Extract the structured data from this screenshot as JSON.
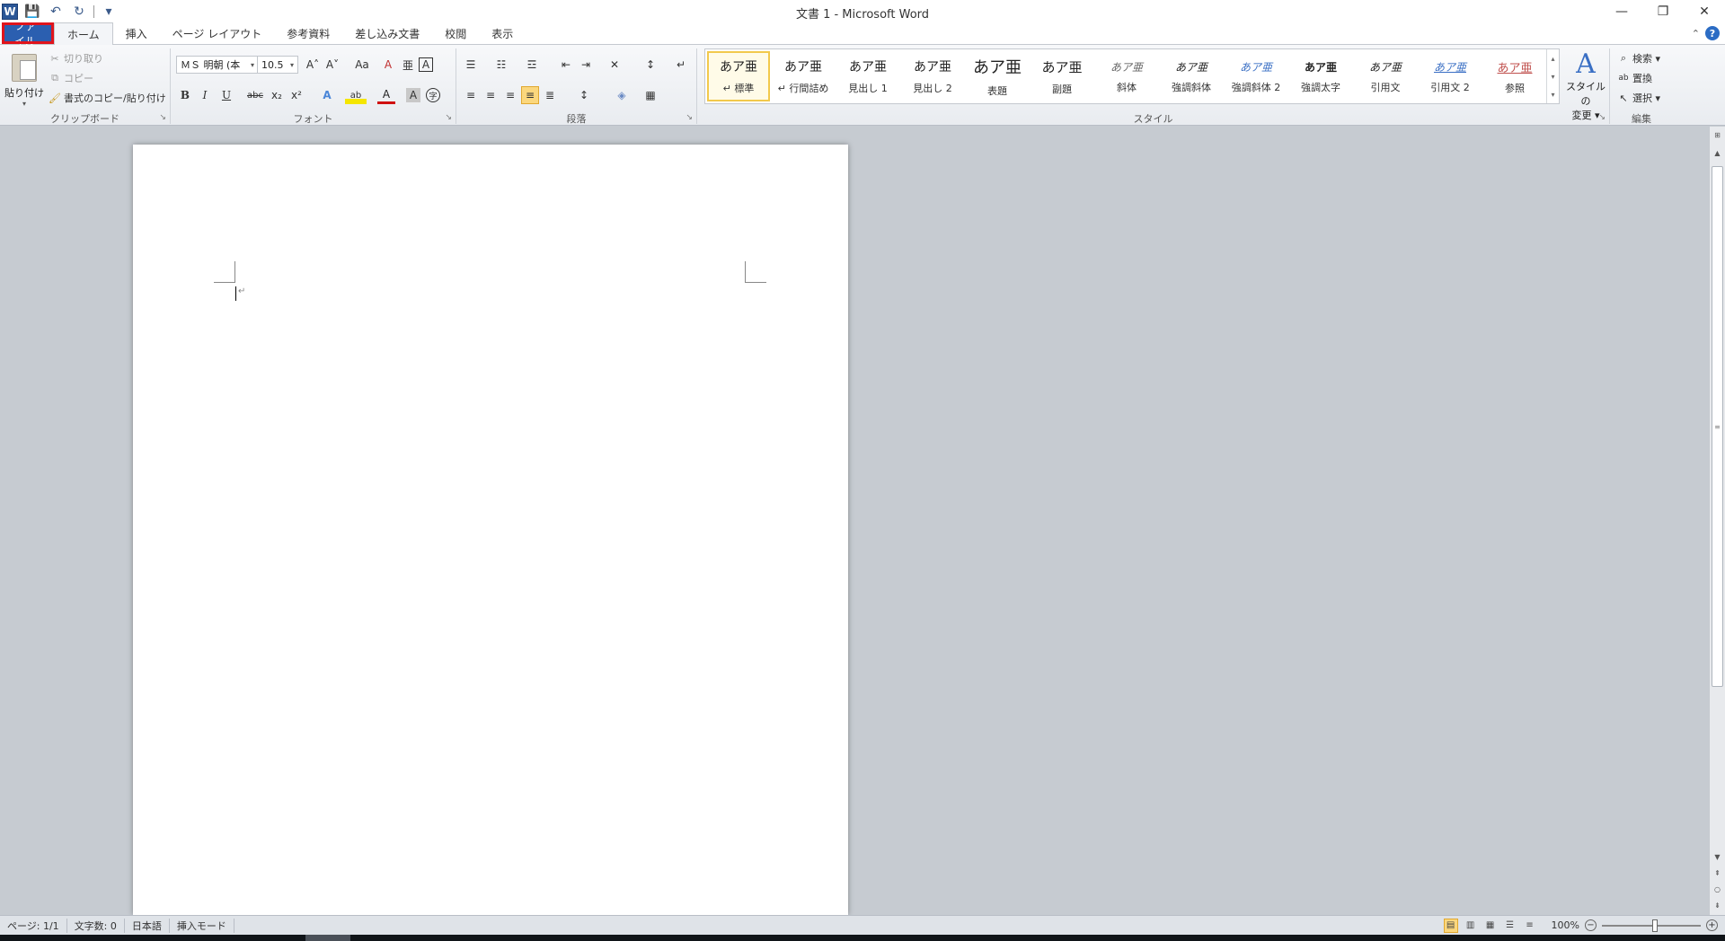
{
  "window": {
    "title": "文書 1 - Microsoft Word",
    "minimize": "—",
    "restore": "❐",
    "close": "✕"
  },
  "qat": {
    "logo": "W",
    "save": "💾",
    "undo": "↶",
    "redo": "↻",
    "customize": "▾"
  },
  "tabs": {
    "file": "ファイル",
    "items": [
      "ホーム",
      "挿入",
      "ページ レイアウト",
      "参考資料",
      "差し込み文書",
      "校閲",
      "表示"
    ],
    "minimize_ribbon": "⌃",
    "help": "?"
  },
  "clipboard": {
    "group_label": "クリップボード",
    "paste": "貼り付け",
    "cut": "切り取り",
    "copy": "コピー",
    "format_painter": "書式のコピー/貼り付け"
  },
  "font": {
    "group_label": "フォント",
    "font_name": "ＭＳ 明朝 (本",
    "font_size": "10.5",
    "grow": "A˄",
    "shrink": "A˅",
    "case": "Aa",
    "clear": "A",
    "phonetic": "亜",
    "border": "A",
    "bold": "B",
    "italic": "I",
    "underline": "U",
    "strike": "abc",
    "subscript": "x₂",
    "superscript": "x²",
    "effects": "A",
    "highlight": "ab",
    "color": "A",
    "shade": "A",
    "enclose": "字"
  },
  "paragraph": {
    "group_label": "段落",
    "bullets": "☰",
    "numbering": "☷",
    "multilevel": "☲",
    "dec_indent": "⇤",
    "inc_indent": "⇥",
    "asian_layout": "✕",
    "sort": "↕",
    "show_marks": "↵",
    "align_left": "≡",
    "center": "≡",
    "align_right": "≡",
    "justify": "≡",
    "distribute": "≣",
    "line_spacing": "↕",
    "shading": "◈",
    "borders": "▦"
  },
  "styles": {
    "group_label": "スタイル",
    "items": [
      {
        "sample": "あア亜",
        "name": "↵ 標準"
      },
      {
        "sample": "あア亜",
        "name": "↵ 行間詰め"
      },
      {
        "sample": "あア亜",
        "name": "見出し 1"
      },
      {
        "sample": "あア亜",
        "name": "見出し 2"
      },
      {
        "sample": "あア亜",
        "name": "表題"
      },
      {
        "sample": "あア亜",
        "name": "副題"
      },
      {
        "sample": "あア亜",
        "name": "斜体"
      },
      {
        "sample": "あア亜",
        "name": "強調斜体"
      },
      {
        "sample": "あア亜",
        "name": "強調斜体 2"
      },
      {
        "sample": "あア亜",
        "name": "強調太字"
      },
      {
        "sample": "あア亜",
        "name": "引用文"
      },
      {
        "sample": "あア亜",
        "name": "引用文 2"
      },
      {
        "sample": "あア亜",
        "name": "参照"
      }
    ],
    "change_styles_line1": "スタイルの",
    "change_styles_line2": "変更 ▾",
    "change_icon": "A"
  },
  "editing": {
    "group_label": "編集",
    "find": "検索 ▾",
    "replace": "置換",
    "select": "選択 ▾"
  },
  "statusbar": {
    "page": "ページ: 1/1",
    "words": "文字数: 0",
    "language": "日本語",
    "mode": "挿入モード",
    "zoom": "100%",
    "zoom_out": "−",
    "zoom_in": "+"
  },
  "colors": {
    "file_tab": "#2b5fb0",
    "highlight_box": "#e0141c",
    "selected_style": "#f2c94c"
  }
}
